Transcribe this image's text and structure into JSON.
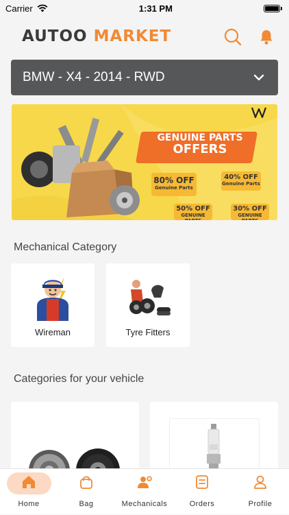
{
  "status_bar": {
    "carrier": "Carrier",
    "time": "1:31 PM"
  },
  "header": {
    "logo_part1": "AUTOO",
    "logo_part2": "MARKET",
    "search_icon": "search-icon",
    "bell_icon": "bell-icon",
    "accent_color": "#f08a34"
  },
  "vehicle": {
    "selected": "BMW - X4 - 2014 - RWD"
  },
  "banner": {
    "title_line1": "GENUINE PARTS",
    "title_line2": "OFFERS",
    "offers": [
      {
        "pct": "80% OFF",
        "sub": "Genuine Parts"
      },
      {
        "pct": "40% OFF",
        "sub": "Genuine Parts"
      },
      {
        "pct": "50% OFF",
        "sub": "GENUINE PARTS"
      },
      {
        "pct": "30% OFF",
        "sub": "GENUINE PARTS"
      }
    ]
  },
  "mechanical": {
    "title": "Mechanical Category",
    "items": [
      {
        "label": "Wireman"
      },
      {
        "label": "Tyre Fitters"
      }
    ]
  },
  "vehicle_categories": {
    "title": "Categories for your vehicle"
  },
  "bottom_nav": {
    "items": [
      {
        "label": "Home",
        "icon": "home-icon",
        "active": true
      },
      {
        "label": "Bag",
        "icon": "bag-icon"
      },
      {
        "label": "Mechanicals",
        "icon": "mechanicals-icon"
      },
      {
        "label": "Orders",
        "icon": "orders-icon"
      },
      {
        "label": "Profile",
        "icon": "profile-icon"
      }
    ]
  }
}
